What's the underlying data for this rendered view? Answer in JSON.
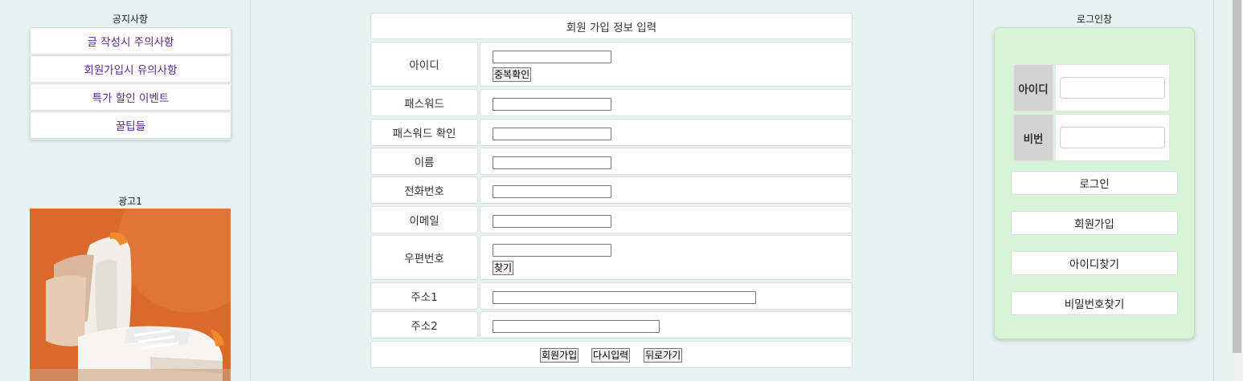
{
  "notice": {
    "title": "공지사항",
    "items": [
      {
        "label": "글 작성시 주의사항"
      },
      {
        "label": "회원가입시 유의사항"
      },
      {
        "label": "특가 할인 이벤트"
      },
      {
        "label": "꿀팁들"
      }
    ]
  },
  "ad": {
    "title": "광고1"
  },
  "form": {
    "header": "회원 가입 정보 입력",
    "labels": {
      "id": "아이디",
      "password": "패스워드",
      "password_confirm": "패스워드 확인",
      "name": "이름",
      "phone": "전화번호",
      "email": "이메일",
      "zipcode": "우편번호",
      "address1": "주소1",
      "address2": "주소2"
    },
    "values": {
      "id": "",
      "password": "",
      "password_confirm": "",
      "name": "",
      "phone": "",
      "email": "",
      "zipcode": "",
      "address1": "",
      "address2": ""
    },
    "buttons": {
      "check_duplicate": "중복확인",
      "find_zip": "찾기",
      "submit": "회원가입",
      "reset": "다시입력",
      "back": "뒤로가기"
    }
  },
  "login": {
    "title": "로그인창",
    "id_label": "아이디",
    "pw_label": "비번",
    "id_value": "",
    "pw_value": "",
    "buttons": {
      "login": "로그인",
      "signup": "회원가입",
      "find_id": "아이디찾기",
      "find_pw": "비밀번호찾기"
    }
  },
  "colors": {
    "page_bg": "#e6f4f1",
    "notice_link": "#5b2a86",
    "login_bg": "#d6f5d6",
    "login_label_bg": "#d3d3d3"
  }
}
